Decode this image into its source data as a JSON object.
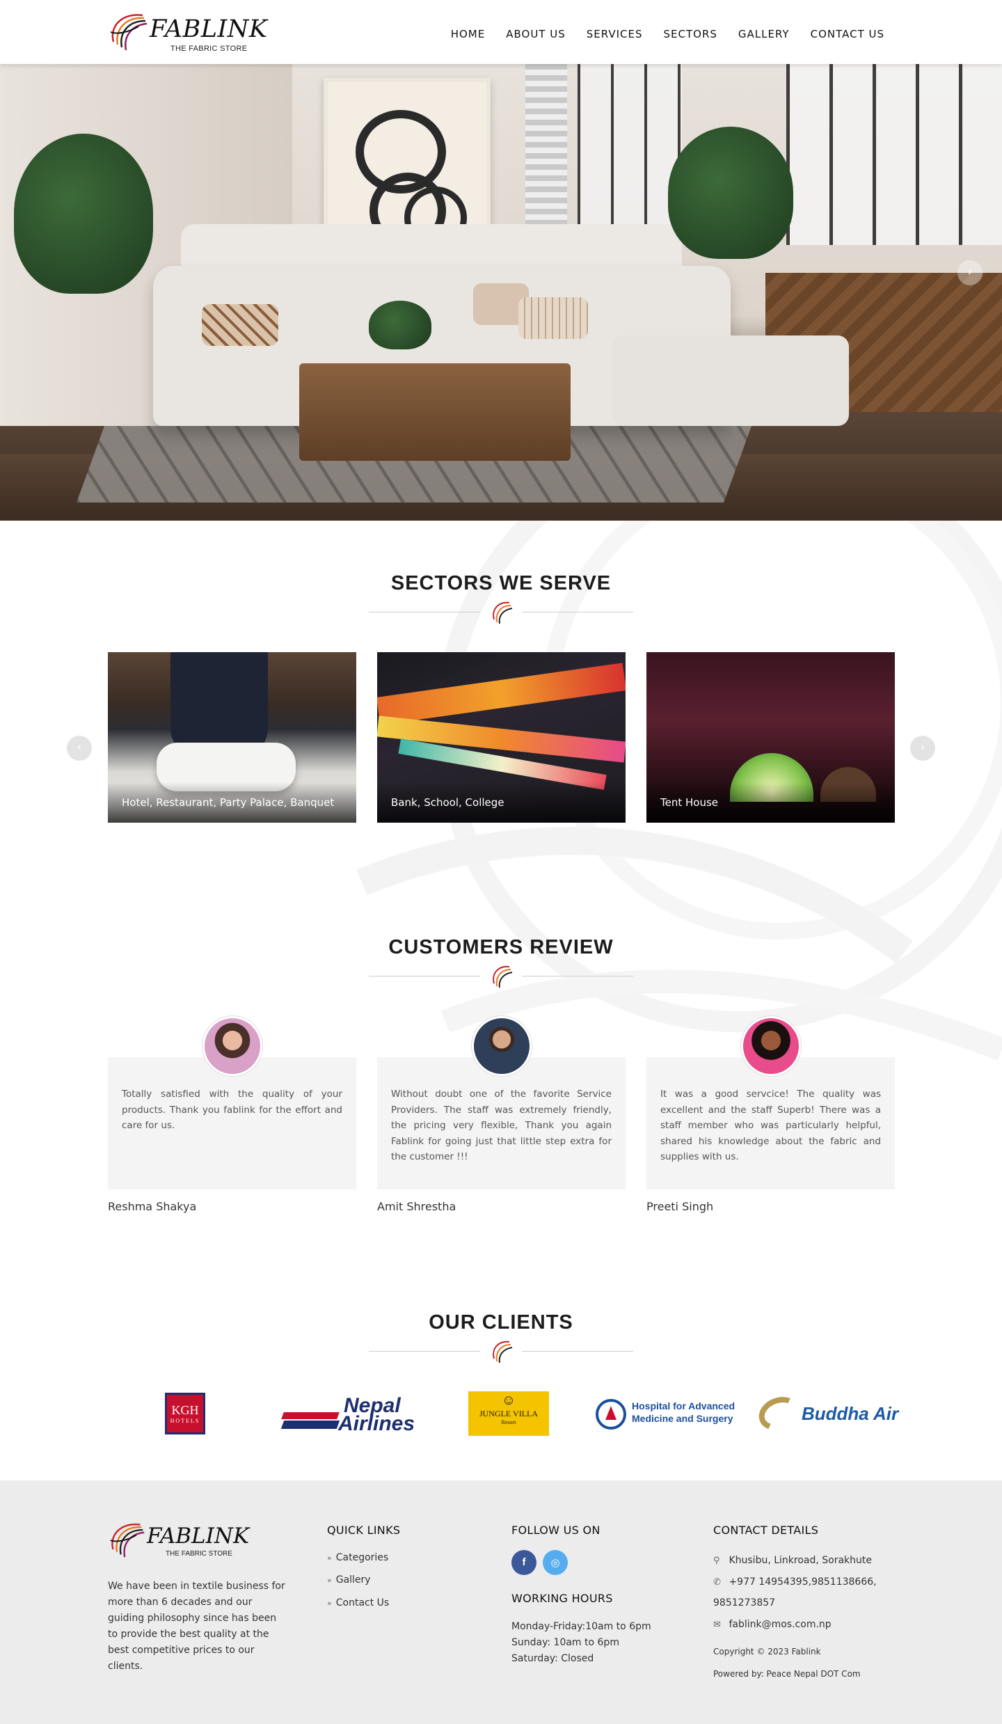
{
  "header": {
    "logo_text": "FABLINK",
    "logo_sub": "THE FABRIC STORE",
    "nav": [
      "HOME",
      "ABOUT US",
      "SERVICES",
      "SECTORS",
      "GALLERY",
      "CONTACT US"
    ]
  },
  "hero": {
    "next_icon": "chevron-right-icon"
  },
  "sectors": {
    "title": "SECTORS WE SERVE",
    "prev_icon": "chevron-left-icon",
    "next_icon": "chevron-right-icon",
    "cards": [
      {
        "caption": "Hotel, Restaurant, Party Palace, Banquet"
      },
      {
        "caption": "Bank, School, College"
      },
      {
        "caption": "Tent House"
      }
    ]
  },
  "reviews": {
    "title": "CUSTOMERS REVIEW",
    "items": [
      {
        "text": "Totally satisfied with the quality of your products. Thank you fablink for the effort and care for us.",
        "name": "Reshma Shakya"
      },
      {
        "text": "Without doubt one of the favorite Service Providers. The staff was extremely friendly, the pricing very flexible, Thank you again Fablink for going just that little step extra for the customer !!!",
        "name": "Amit Shrestha"
      },
      {
        "text": "It was a good servcice! The quality was excellent and the staff Superb! There was a staff member who was particularly helpful, shared his knowledge about the fabric and supplies with us.",
        "name": "Preeti Singh"
      }
    ]
  },
  "clients": {
    "title": "OUR CLIENTS",
    "logos": [
      {
        "line1": "KGH",
        "line2": "HOTELS"
      },
      {
        "line1": "Nepal",
        "line2": "Airlines"
      },
      {
        "line1": "JUNGLE VILLA",
        "line2": "Resort"
      },
      {
        "line1": "Hospital for Advanced",
        "line2": "Medicine and Surgery"
      },
      {
        "line1": "Buddha Air",
        "line2": ""
      }
    ]
  },
  "footer": {
    "logo_text": "FABLINK",
    "logo_sub": "THE FABRIC STORE",
    "about": "We have been in textile business for more than 6 decades and our guiding philosophy since has been to provide the best quality at the best competitive prices to our clients.",
    "quick_links_title": "QUICK LINKS",
    "quick_links": [
      "Categories",
      "Gallery",
      "Contact Us"
    ],
    "follow_title": "FOLLOW US ON",
    "social": [
      {
        "icon": "facebook-icon",
        "glyph": "f",
        "color": "#3b5998"
      },
      {
        "icon": "instagram-icon",
        "glyph": "◎",
        "color": "#55acee"
      }
    ],
    "hours_title": "WORKING HOURS",
    "hours": [
      "Monday-Friday:10am to 6pm",
      "Sunday: 10am to 6pm",
      "Saturday: Closed"
    ],
    "contact_title": "CONTACT DETAILS",
    "address": "Khusibu, Linkroad, Sorakhute",
    "phone_line1": "+977 14954395,9851138666,",
    "phone_line2": "9851273857",
    "email": "fablink@mos.com.np",
    "copyright": "Copyright ©  2023 Fablink",
    "powered": "Powered by: Peace Nepal DOT Com"
  }
}
